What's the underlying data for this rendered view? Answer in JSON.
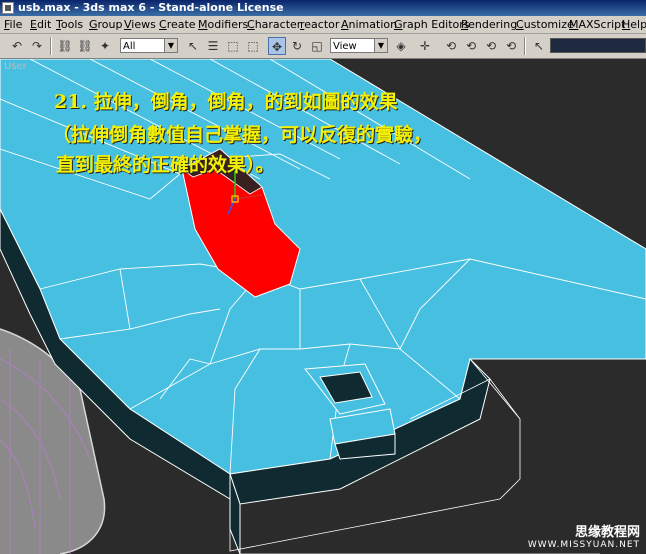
{
  "window": {
    "title": "usb.max - 3ds max 6 - Stand-alone License"
  },
  "menu": [
    "File",
    "Edit",
    "Tools",
    "Group",
    "Views",
    "Create",
    "Modifiers",
    "Character",
    "reactor",
    "Animation",
    "Graph Editors",
    "Rendering",
    "Customize",
    "MAXScript",
    "Help"
  ],
  "toolbar": {
    "selection_filter": "All",
    "reference_coord": "View",
    "named_selection": ""
  },
  "viewport": {
    "label": "User",
    "annotation_line1": "21.   拉伸，倒角，倒角，的到如圖的效果",
    "annotation_line2": "（拉伸倒角數值自己掌握，可以反復的實驗，",
    "annotation_line3": "直到最終的正確的效果）。",
    "watermark_line1": "思缘教程网",
    "watermark_line2": "WWW.MISSYUAN.NET"
  },
  "colors": {
    "model_face": "#3fb6d9",
    "model_edge": "#ffffff",
    "selected_face": "#ff0000",
    "viewport_bg": "#2b2b2b",
    "annotation": "#f4f000"
  }
}
